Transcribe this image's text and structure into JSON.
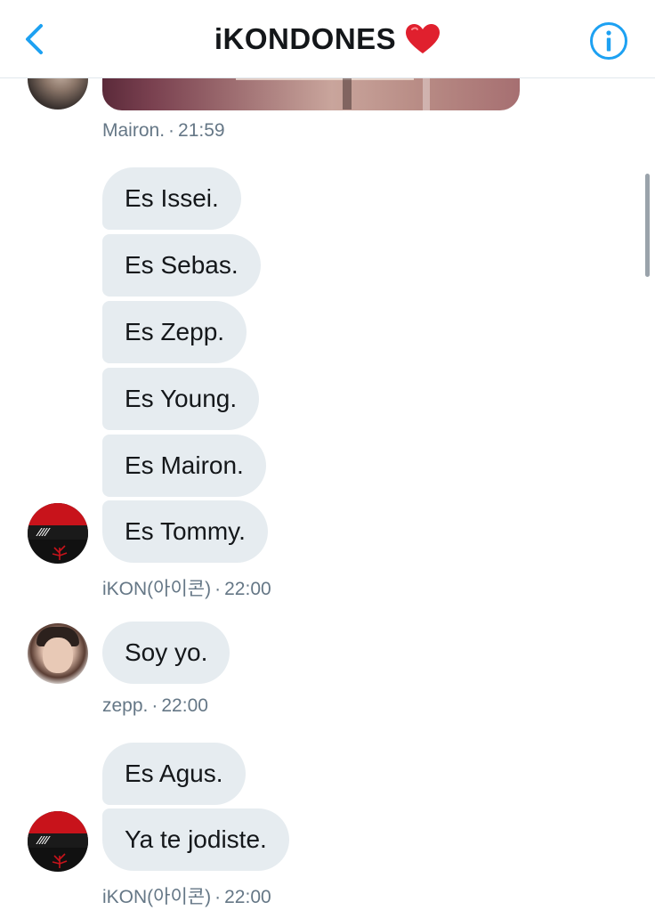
{
  "header": {
    "title": "iKONDONES",
    "title_emoji": "❤️",
    "accent_color": "#1da1f2"
  },
  "messages": {
    "group1_meta": {
      "sender": "Mairon.",
      "time": "21:59"
    },
    "group2": {
      "bubbles": [
        "Es Issei.",
        "Es Sebas.",
        "Es Zepp.",
        "Es Young.",
        "Es Mairon.",
        "Es Tommy."
      ],
      "sender": "iKON(아이콘)",
      "time": "22:00"
    },
    "group3": {
      "bubbles": [
        "Soy yo."
      ],
      "sender": "zepp.",
      "time": "22:00"
    },
    "group4": {
      "bubbles": [
        "Es Agus.",
        "Ya te jodiste."
      ],
      "sender": "iKON(아이콘)",
      "time": "22:00"
    }
  },
  "icons": {
    "back": "chevron-left-icon",
    "info": "info-icon"
  }
}
